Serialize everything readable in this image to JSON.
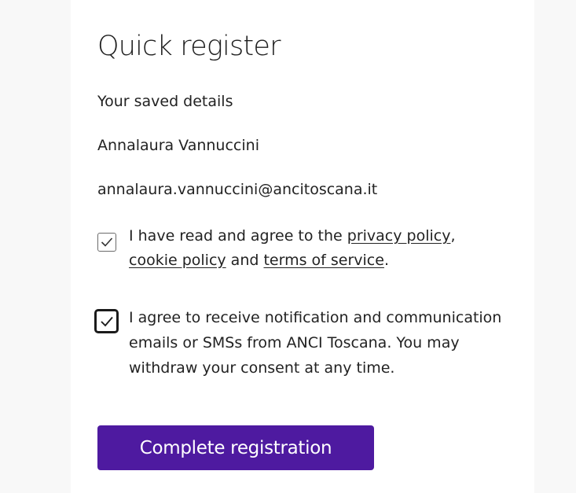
{
  "form": {
    "title": "Quick register",
    "subtitle": "Your saved details",
    "name": "Annalaura Vannuccini",
    "email": "annalaura.vannuccini@ancitoscana.it"
  },
  "consent_terms": {
    "checked": true,
    "text_1": "I have read and agree to the ",
    "privacy_link": "privacy policy",
    "text_2": ",",
    "cookie_link": "cookie policy",
    "text_3": " and ",
    "terms_link": "terms of service",
    "text_4": "."
  },
  "consent_marketing": {
    "checked": true,
    "text": "I agree to receive notification and communication emails or SMSs from ANCI Toscana. You may withdraw your consent at any time."
  },
  "actions": {
    "submit_label": "Complete registration",
    "submit_color": "#4e1aa0"
  }
}
